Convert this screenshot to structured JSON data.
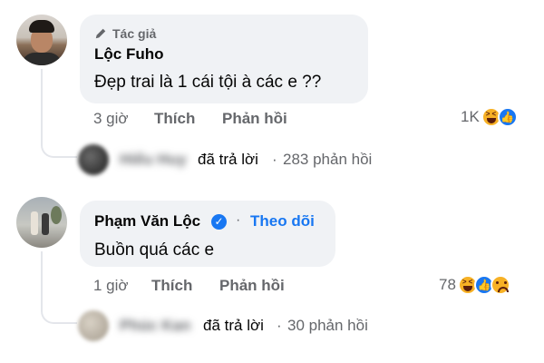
{
  "comments": [
    {
      "author_badge": "Tác giả",
      "name": "Lộc Fuho",
      "text": "Đẹp trai là 1 cái tội à các e ??",
      "time": "3 giờ",
      "like_label": "Thích",
      "reply_label": "Phản hồi",
      "reaction_count": "1K",
      "reactions": [
        "haha",
        "like"
      ],
      "replies": {
        "replier_name": "Hiếu Huy",
        "replied_label": "đã trả lời",
        "separator": "·",
        "reply_count": "283 phản hồi"
      }
    },
    {
      "name": "Phạm Văn Lộc",
      "verified": "✓",
      "dot": "·",
      "follow_label": "Theo dõi",
      "text": "Buồn quá các e",
      "time": "1 giờ",
      "like_label": "Thích",
      "reply_label": "Phản hồi",
      "reaction_count": "78",
      "reactions": [
        "haha",
        "like",
        "sad"
      ],
      "replies": {
        "replier_name": "Phúc Kan",
        "replied_label": "đã trả lời",
        "separator": "·",
        "reply_count": "30 phản hồi"
      }
    }
  ],
  "colors": {
    "link_blue": "#1877f2",
    "secondary_text": "#65676b",
    "bubble_bg": "#f0f2f5",
    "like_blue": "#1877f2",
    "emoji_yellow": "#f7b125"
  },
  "like_glyph": "👍"
}
